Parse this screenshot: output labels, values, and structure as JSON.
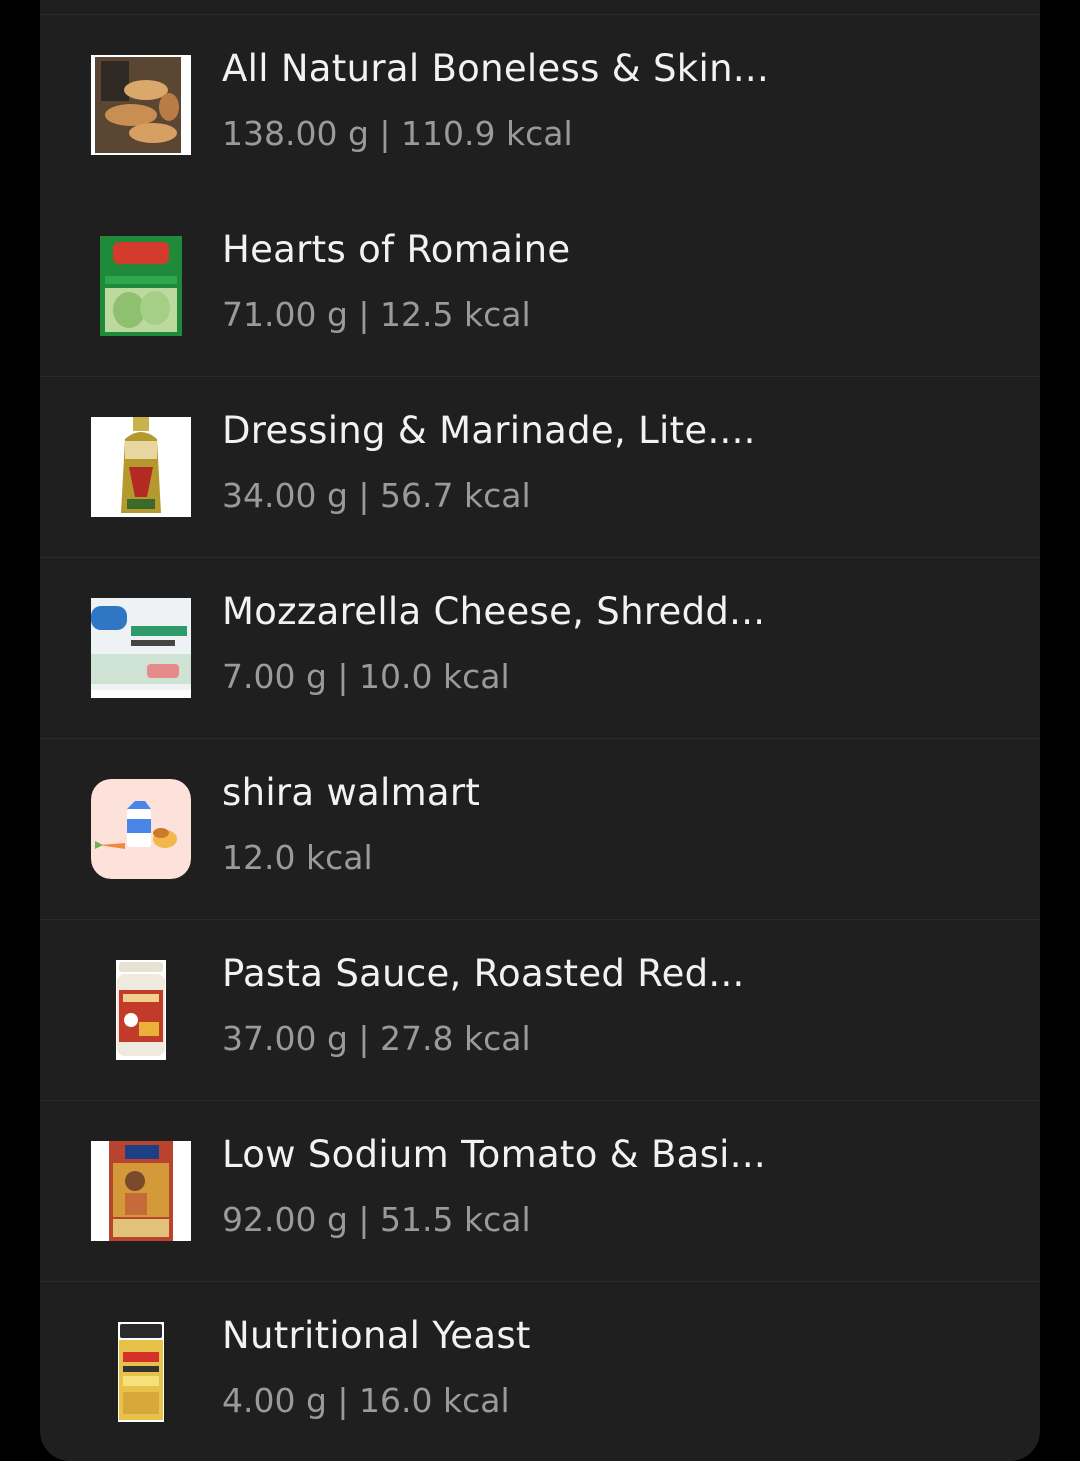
{
  "colors": {
    "background": "#000000",
    "card": "#1f1f20",
    "divider": "#2b2b2c",
    "title_text": "#f2f2f2",
    "detail_text": "#9a9a9c"
  },
  "food_items": [
    {
      "name": "All Natural Boneless & Skin...",
      "detail": "138.00 g | 110.9 kcal",
      "icon": "chicken-package-icon"
    },
    {
      "name": "Hearts of Romaine",
      "detail": "71.00 g | 12.5 kcal",
      "icon": "romaine-bag-icon"
    },
    {
      "name": "Dressing & Marinade, Lite....",
      "detail": "34.00 g | 56.7 kcal",
      "icon": "dressing-bottle-icon"
    },
    {
      "name": "Mozzarella Cheese, Shredd...",
      "detail": "7.00 g | 10.0 kcal",
      "icon": "mozzarella-bag-icon"
    },
    {
      "name": "shira walmart",
      "detail": "12.0 kcal",
      "icon": "custom-food-icon"
    },
    {
      "name": "Pasta Sauce, Roasted Red...",
      "detail": "37.00 g | 27.8 kcal",
      "icon": "pasta-sauce-jar-icon"
    },
    {
      "name": "Low Sodium Tomato & Basi...",
      "detail": "92.00 g | 51.5 kcal",
      "icon": "tomato-basil-jar-icon"
    },
    {
      "name": "Nutritional Yeast",
      "detail": "4.00 g | 16.0 kcal",
      "icon": "nutritional-yeast-shaker-icon"
    }
  ]
}
